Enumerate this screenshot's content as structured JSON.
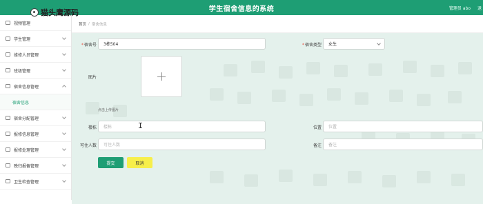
{
  "app": {
    "title": "学生宿舍信息的系统",
    "user_text": "管理员 abo",
    "logout": "退",
    "watermark": "猫头鹰源码"
  },
  "sidebar": {
    "items": [
      {
        "label": "视频管理"
      },
      {
        "label": "学生管理"
      },
      {
        "label": "维修人员管理"
      },
      {
        "label": "班级管理"
      },
      {
        "label": "宿舍信息管理",
        "open": true
      },
      {
        "label": "宿舍信息",
        "sub": true
      },
      {
        "label": "宿舍分配管理"
      },
      {
        "label": "报修信息管理"
      },
      {
        "label": "报修处理管理"
      },
      {
        "label": "晚归报备管理"
      },
      {
        "label": "卫生检查管理"
      }
    ]
  },
  "breadcrumb": {
    "home": "首页",
    "sep": "/",
    "current": "宿舍信息"
  },
  "form": {
    "room_no_label": "宿舍号",
    "room_no_value": "3栋504",
    "room_type_label": "宿舍类型",
    "room_type_value": "女生",
    "photo_label": "图片",
    "photo_hint": "点击上传图片",
    "building_label": "楼栋",
    "building_placeholder": "楼栋",
    "location_label": "位置",
    "location_placeholder": "位置",
    "occupants_label": "可住人数",
    "occupants_placeholder": "可住人数",
    "remark_label": "备注",
    "remark_placeholder": "备注",
    "submit": "提交",
    "cancel": "取消"
  },
  "colors": {
    "brand": "#1e9e74",
    "cancel_button": "#f7ef4a"
  }
}
